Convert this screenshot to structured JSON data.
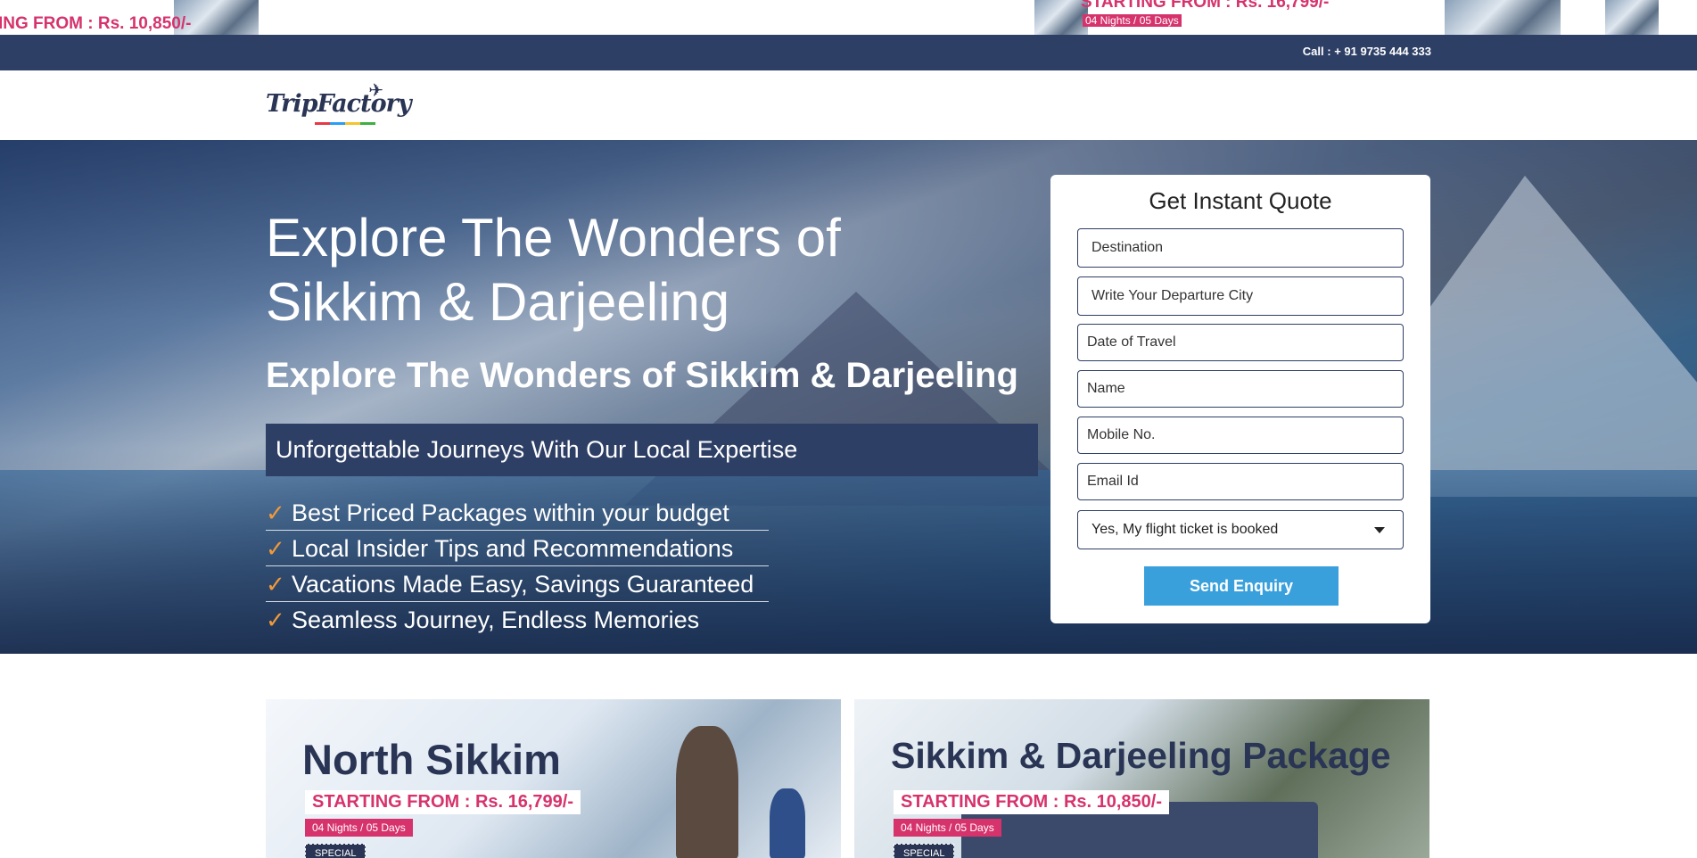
{
  "top_strip": {
    "price_left": "ING FROM : Rs. 10,850/-",
    "price_right": "STARTING FROM : Rs. 16,799/-",
    "tag_nights": "04 Nights / 05 Days"
  },
  "call_bar": {
    "text": "Call : + 91 9735 444 333"
  },
  "header": {
    "logo_text": "TripFactory",
    "logo_plane": "✈"
  },
  "hero": {
    "title": "Explore The Wonders of Sikkim & Darjeeling",
    "subtitle": "Explore The Wonders of Sikkim & Darjeeling",
    "banner": "Unforgettable Journeys With Our Local Expertise",
    "check_glyph": "✓",
    "features": [
      "Best Priced Packages within your budget",
      "Local Insider Tips and Recommendations",
      "Vacations Made Easy, Savings Guaranteed",
      "Seamless Journey, Endless Memories"
    ]
  },
  "quote_form": {
    "title": "Get Instant Quote",
    "destination_placeholder": "Destination",
    "departure_placeholder": "Write Your Departure City",
    "date_placeholder": "Date of Travel",
    "name_placeholder": "Name",
    "mobile_placeholder": "Mobile No.",
    "email_placeholder": "Email Id",
    "flight_selected": "Yes, My flight ticket is booked",
    "submit_label": "Send Enquiry"
  },
  "packages": [
    {
      "title": "North Sikkim",
      "price": "STARTING FROM : Rs. 16,799/-",
      "duration": "04 Nights / 05 Days",
      "badge": "SPECIAL"
    },
    {
      "title": "Sikkim & Darjeeling Package",
      "price": "STARTING FROM : Rs. 10,850/-",
      "duration": "04 Nights / 05 Days",
      "badge": "SPECIAL"
    }
  ],
  "colors": {
    "navy": "#2e3f66",
    "accent_pink": "#d6336c",
    "button_blue": "#3aa0dc",
    "check_orange": "#f0993a"
  }
}
